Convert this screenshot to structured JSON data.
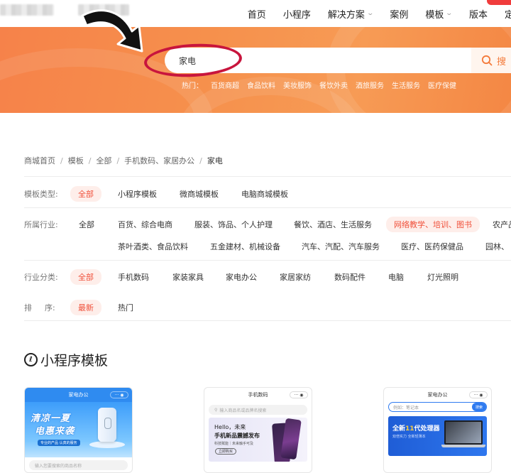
{
  "nav": {
    "items": [
      "首页",
      "小程序",
      "解决方案",
      "案例",
      "模板",
      "版本",
      "定"
    ]
  },
  "search": {
    "value": "家电",
    "button_label": "搜",
    "hot_label": "热门：",
    "hot_items": [
      "百货商超",
      "食品饮料",
      "美妆服饰",
      "餐饮外卖",
      "酒旅服务",
      "生活服务",
      "医疗保健"
    ]
  },
  "breadcrumb": [
    "商城首页",
    "模板",
    "全部",
    "手机数码、家居办公",
    "家电"
  ],
  "filters": {
    "template_type": {
      "label": "模板类型:",
      "options": [
        "全部",
        "小程序模板",
        "微商城模板",
        "电脑商城模板"
      ]
    },
    "industry": {
      "label": "所属行业:",
      "row1": [
        "全部",
        "百货、综合电商",
        "服装、饰品、个人护理",
        "餐饮、酒店、生活服务",
        "网络教学、培训、图书",
        "农产品"
      ],
      "row2": [
        "茶叶酒类、食品饮料",
        "五金建材、机械设备",
        "汽车、汽配、汽车服务",
        "医疗、医药保健品",
        "园林、"
      ]
    },
    "category": {
      "label": "行业分类:",
      "options": [
        "全部",
        "手机数码",
        "家装家具",
        "家电办公",
        "家居家纺",
        "数码配件",
        "电脑",
        "灯光照明"
      ]
    },
    "sort": {
      "label_a": "排",
      "label_b": "序:",
      "options": [
        "最新",
        "热门"
      ]
    }
  },
  "section": {
    "icon_glyph": "ℓ",
    "title": "小程序模板"
  },
  "cards": [
    {
      "title": "家电办公",
      "banner_line1": "清凉一夏",
      "banner_line2": "电惠来袭",
      "banner_tag": "专业的产品 认真的服务",
      "search_placeholder": "输入您要搜索的商品名称"
    },
    {
      "title": "手机数码",
      "search_placeholder": "输入商品名或品牌名搜索",
      "banner_line1": "Hello，未来",
      "banner_line2": "手机新品震撼发布",
      "banner_line3": "科技赋能｜未来触手可及",
      "banner_button": "立即购买"
    },
    {
      "title": "家电办公",
      "search_placeholder": "例如：笔记本",
      "search_button": "搜索",
      "banner_line1_pre": "全新",
      "banner_line1_hl": "11",
      "banner_line1_post": "代处理器",
      "banner_line2": "双倍实力 全新轻薄本"
    }
  ],
  "colors": {
    "accent": "#f0503a",
    "hero": "#f6904c",
    "circle": "#c8153d"
  }
}
